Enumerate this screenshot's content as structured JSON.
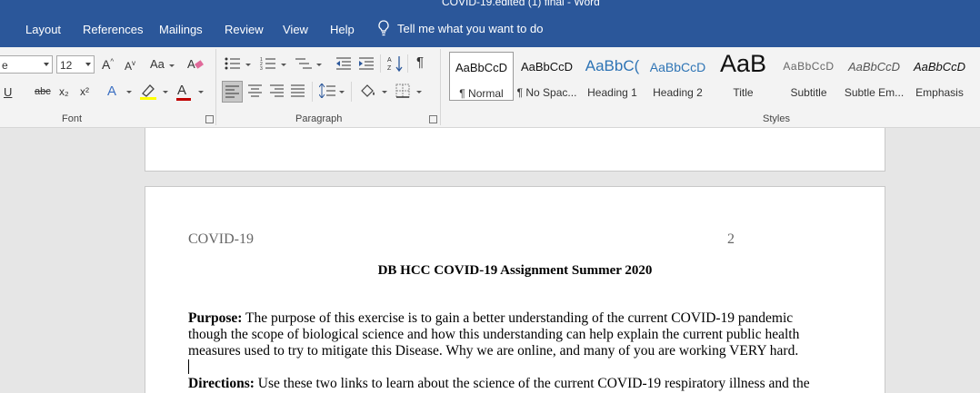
{
  "window": {
    "title": "COVID-19.edited (1) final  -  Word"
  },
  "menu": {
    "tabs": [
      "Layout",
      "References",
      "Mailings",
      "Review",
      "View",
      "Help"
    ],
    "tell_me": "Tell me what you want to do"
  },
  "font": {
    "name_value": "e",
    "size_value": "12",
    "grow_label": "A",
    "shrink_label": "A",
    "case_label": "Aa",
    "underline_label": "U",
    "strike_label": "abc",
    "subscript_label": "x₂",
    "superscript_label": "x²",
    "effects_label": "A",
    "font_color_label": "A",
    "group_label": "Font"
  },
  "paragraph": {
    "group_label": "Paragraph",
    "pilcrow": "¶"
  },
  "styles": {
    "group_label": "Styles",
    "items": [
      {
        "preview": "AaBbCcD",
        "name": "¶ Normal"
      },
      {
        "preview": "AaBbCcD",
        "name": "¶ No Spac..."
      },
      {
        "preview": "AaBbC(",
        "name": "Heading 1"
      },
      {
        "preview": "AaBbCcD",
        "name": "Heading 2"
      },
      {
        "preview": "AaB",
        "name": "Title"
      },
      {
        "preview": "AaBbCcD",
        "name": "Subtitle"
      },
      {
        "preview": "AaBbCcD",
        "name": "Subtle Em..."
      },
      {
        "preview": "AaBbCcD",
        "name": "Emphasis"
      }
    ]
  },
  "colors": {
    "ribbon_blue": "#2b579a",
    "font_color": "#c00000",
    "highlight": "#ffff00"
  },
  "document": {
    "header_left": "COVID-19",
    "header_right": "2",
    "heading": "DB HCC COVID-19 Assignment Summer 2020",
    "purpose_label": "Purpose:",
    "purpose_line1": " The purpose of this exercise is to gain a better understanding of the current COVID-19 pandemic",
    "purpose_line2": "though the scope of biological science and how this understanding can help explain the current public health",
    "purpose_line3": "measures used to try to mitigate this Disease.  Why we are online, and many of you are working VERY hard.",
    "directions_label": "Directions:",
    "directions_line1": " Use these two links to learn about the science of the current COVID-19 respiratory illness and the"
  }
}
